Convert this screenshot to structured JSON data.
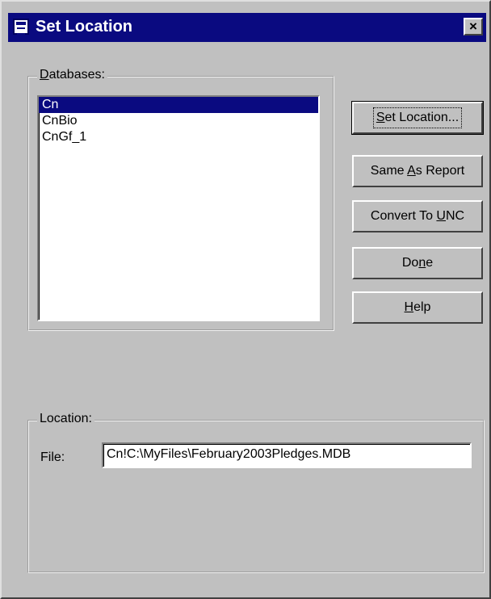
{
  "window": {
    "title": "Set Location",
    "close_glyph": "×",
    "title_icon": "window-icon"
  },
  "databases": {
    "label": "Databases:",
    "accel": "D",
    "rest": "atabases:",
    "items": [
      {
        "label": "Cn",
        "selected": true
      },
      {
        "label": "CnBio",
        "selected": false
      },
      {
        "label": "CnGf_1",
        "selected": false
      }
    ]
  },
  "buttons": {
    "set_location": {
      "before": "",
      "accel": "S",
      "after": "et Location..."
    },
    "same_as_report": {
      "before": "Same ",
      "accel": "A",
      "after": "s Report"
    },
    "convert_to_unc": {
      "before": "Convert To ",
      "accel": "U",
      "after": "NC"
    },
    "done": {
      "before": "Do",
      "accel": "n",
      "after": "e"
    },
    "help": {
      "before": "",
      "accel": "H",
      "after": "elp"
    }
  },
  "location": {
    "label": "Location:",
    "file_label": "File:",
    "file_value": "Cn!C:\\MyFiles\\February2003Pledges.MDB"
  }
}
